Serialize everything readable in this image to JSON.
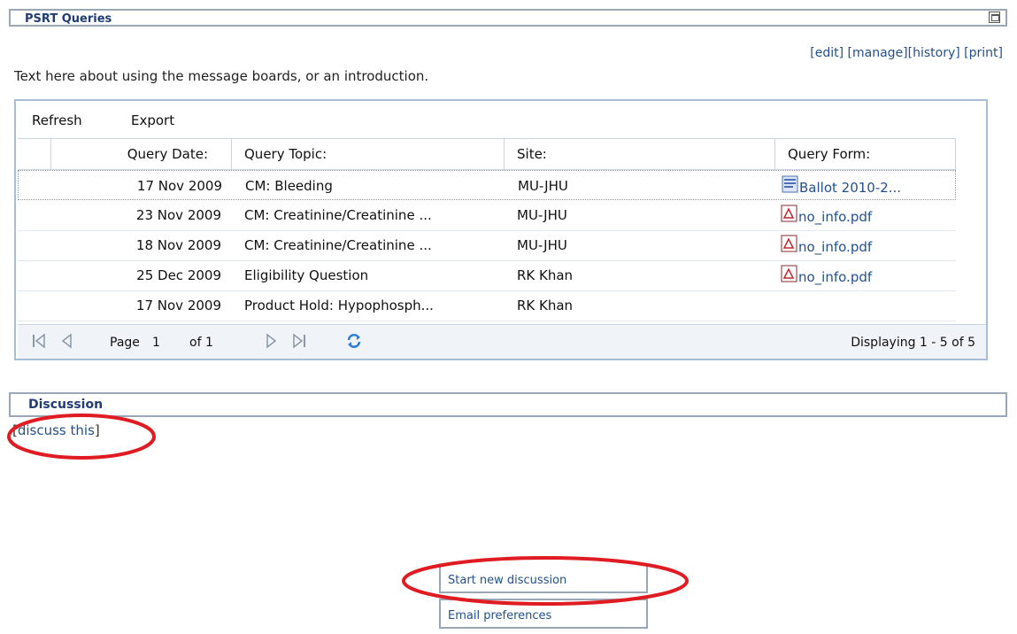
{
  "panel": {
    "title": "PSRT Queries"
  },
  "actions": {
    "edit": "[edit]",
    "manage": "[manage]",
    "history": "[history]",
    "print": "[print]"
  },
  "intro": "Text here about using the message boards, or an introduction.",
  "toolbar": {
    "refresh": "Refresh",
    "export": "Export"
  },
  "columns": {
    "date": "Query Date:",
    "topic": "Query Topic:",
    "site": "Site:",
    "form": "Query Form:"
  },
  "rows": [
    {
      "date": "17 Nov 2009",
      "topic": "CM: Bleeding",
      "site": "MU-JHU",
      "form": "Ballot 2010-2...",
      "icon": "word-doc-icon"
    },
    {
      "date": "23 Nov 2009",
      "topic": "CM: Creatinine/Creatinine ...",
      "site": "MU-JHU",
      "form": "no_info.pdf",
      "icon": "pdf-icon"
    },
    {
      "date": "18 Nov 2009",
      "topic": "CM: Creatinine/Creatinine ...",
      "site": "MU-JHU",
      "form": "no_info.pdf",
      "icon": "pdf-icon"
    },
    {
      "date": "25 Dec 2009",
      "topic": "Eligibility Question",
      "site": "RK Khan",
      "form": "no_info.pdf",
      "icon": "pdf-icon"
    },
    {
      "date": "17 Nov 2009",
      "topic": "Product Hold: Hypophosph...",
      "site": "RK Khan",
      "form": "",
      "icon": ""
    }
  ],
  "pager": {
    "page_label": "Page",
    "page_value": "1",
    "of_label": "of 1",
    "display": "Displaying 1 - 5 of 5"
  },
  "discussion": {
    "title": "Discussion",
    "discuss_link": "discuss this"
  },
  "menu": {
    "start": "Start new discussion",
    "email": "Email preferences"
  },
  "colors": {
    "link": "#23508e",
    "title": "#1f3c78",
    "border": "#9aa7b6",
    "highlight_circle": "#e01b22"
  }
}
